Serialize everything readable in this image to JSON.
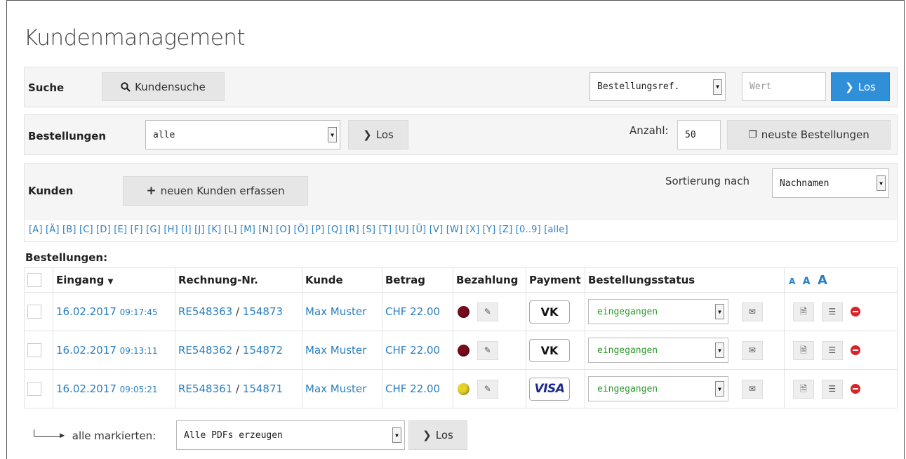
{
  "title": "Kundenmanagement",
  "search": {
    "label": "Suche",
    "customer_search_button": "Kundensuche",
    "field_select": "Bestellungsref.",
    "value_placeholder": "Wert",
    "go_button": "Los"
  },
  "orders_panel": {
    "label": "Bestellungen",
    "filter_select": "alle",
    "go_button": "Los",
    "count_label": "Anzahl:",
    "count_value": "50",
    "latest_button": "neuste Bestellungen"
  },
  "customers_panel": {
    "label": "Kunden",
    "new_customer_button": "neuen Kunden erfassen",
    "sort_label": "Sortierung nach",
    "sort_select": "Nachnamen",
    "letters": [
      "[A]",
      "[Ä]",
      "[B]",
      "[C]",
      "[D]",
      "[E]",
      "[F]",
      "[G]",
      "[H]",
      "[I]",
      "[J]",
      "[K]",
      "[L]",
      "[M]",
      "[N]",
      "[O]",
      "[Ö]",
      "[P]",
      "[Q]",
      "[R]",
      "[S]",
      "[T]",
      "[U]",
      "[Ü]",
      "[V]",
      "[W]",
      "[X]",
      "[Y]",
      "[Z]",
      "[0..9]",
      "[alle]"
    ]
  },
  "orders_table": {
    "section_title": "Bestellungen:",
    "headers": {
      "eingang": "Eingang",
      "rechnung": "Rechnung-Nr.",
      "kunde": "Kunde",
      "betrag": "Betrag",
      "bezahlung": "Bezahlung",
      "payment": "Payment",
      "status": "Bestellungsstatus",
      "font_sizes": [
        "A",
        "A",
        "A"
      ]
    },
    "rows": [
      {
        "date": "16.02.2017",
        "time": "09:17:45",
        "invoice": "RE548363",
        "order_no": "154873",
        "customer": "Max Muster",
        "amount": "CHF 22.00",
        "pay_color": "#7a0a1e",
        "payment": "VK",
        "status": "eingegangen"
      },
      {
        "date": "16.02.2017",
        "time": "09:13:11",
        "invoice": "RE548362",
        "order_no": "154872",
        "customer": "Max Muster",
        "amount": "CHF 22.00",
        "pay_color": "#7a0a1e",
        "payment": "VK",
        "status": "eingegangen"
      },
      {
        "date": "16.02.2017",
        "time": "09:05:21",
        "invoice": "RE548361",
        "order_no": "154871",
        "customer": "Max Muster",
        "amount": "CHF 22.00",
        "pay_color": "#e8d22a",
        "payment": "VISA",
        "status": "eingegangen"
      }
    ],
    "separator": "/"
  },
  "bulk": {
    "label": "alle markierten:",
    "action_select": "Alle PDFs erzeugen",
    "go_button": "Los"
  },
  "colors": {
    "link": "#2a7fc0",
    "primary_button": "#2f8fd8",
    "status_text": "#2a9a2a",
    "delete": "#d9232a"
  }
}
